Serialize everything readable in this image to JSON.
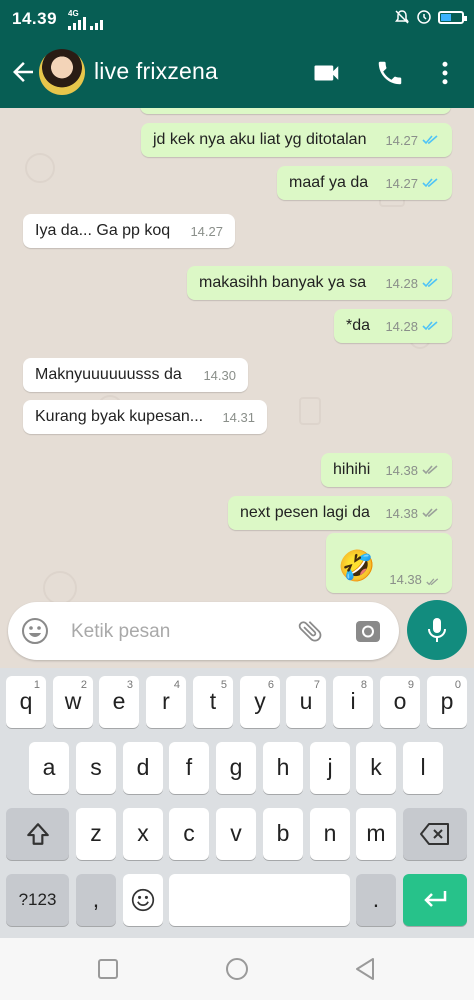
{
  "status_bar": {
    "time": "14.39",
    "network": "4G"
  },
  "header": {
    "title": "live frixzena"
  },
  "messages": [
    {
      "dir": "out",
      "text": "jd kek nya aku liat yg ditotalan",
      "time": "14.27",
      "status": "read"
    },
    {
      "dir": "out",
      "text": "maaf ya da",
      "time": "14.27",
      "status": "read"
    },
    {
      "dir": "in",
      "text": "Iya da...  Ga pp koq",
      "time": "14.27"
    },
    {
      "dir": "out",
      "text": "makasihh banyak ya sa",
      "time": "14.28",
      "status": "read"
    },
    {
      "dir": "out",
      "text": "*da",
      "time": "14.28",
      "status": "read"
    },
    {
      "dir": "in",
      "text": "Maknyuuuuuusss da",
      "time": "14.30"
    },
    {
      "dir": "in",
      "text": "Kurang byak kupesan...",
      "time": "14.31"
    },
    {
      "dir": "out",
      "text": "hihihi",
      "time": "14.38",
      "status": "delivered"
    },
    {
      "dir": "out",
      "text": "next pesen lagi da",
      "time": "14.38",
      "status": "delivered"
    },
    {
      "dir": "out",
      "text": "🤣",
      "time": "14.38",
      "status": "delivered"
    }
  ],
  "composer": {
    "placeholder": "Ketik pesan"
  },
  "keyboard": {
    "row1": [
      {
        "k": "q",
        "s": "1"
      },
      {
        "k": "w",
        "s": "2"
      },
      {
        "k": "e",
        "s": "3"
      },
      {
        "k": "r",
        "s": "4"
      },
      {
        "k": "t",
        "s": "5"
      },
      {
        "k": "y",
        "s": "6"
      },
      {
        "k": "u",
        "s": "7"
      },
      {
        "k": "i",
        "s": "8"
      },
      {
        "k": "o",
        "s": "9"
      },
      {
        "k": "p",
        "s": "0"
      }
    ],
    "row2": [
      "a",
      "s",
      "d",
      "f",
      "g",
      "h",
      "j",
      "k",
      "l"
    ],
    "row3": [
      "z",
      "x",
      "c",
      "v",
      "b",
      "n",
      "m"
    ],
    "num_key": "?123",
    "comma": ",",
    "period": "."
  },
  "colors": {
    "header": "#075e54",
    "outgoing": "#dcf8c6",
    "incoming": "#ffffff",
    "read_ticks": "#4fc3f7",
    "mic": "#128c7e",
    "enter": "#27c28a"
  }
}
